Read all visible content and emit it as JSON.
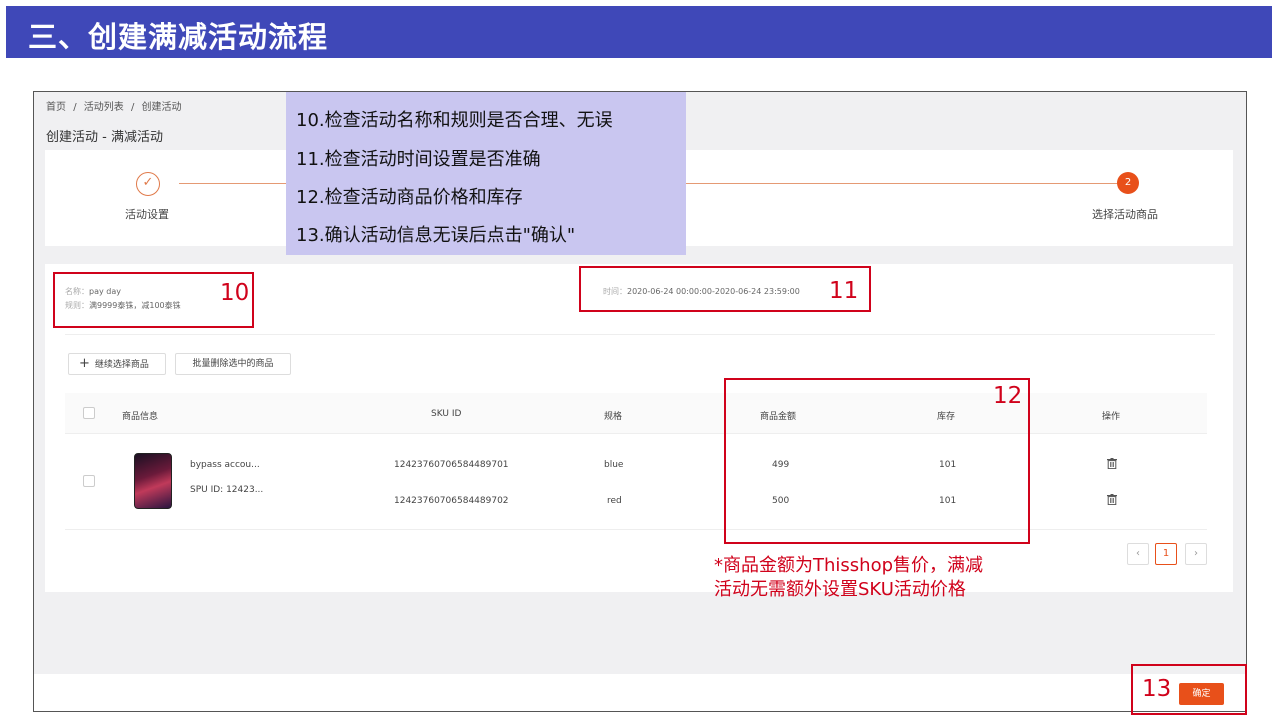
{
  "slide_title": "三、创建满减活动流程",
  "breadcrumb": [
    "首页",
    "/",
    "活动列表",
    "/",
    "创建活动"
  ],
  "page_title": "创建活动 - 满减活动",
  "steps": {
    "step1": {
      "icon": "✓",
      "label": "活动设置"
    },
    "step2": {
      "number": "2",
      "label": "选择活动商品"
    }
  },
  "activity_info": {
    "name_label": "名称：",
    "name_value": "pay day",
    "rule_label": "规则：",
    "rule_value": "满9999泰铢，减100泰铢",
    "time_label": "时间：",
    "time_value": "2020-06-24 00:00:00-2020-06-24 23:59:00"
  },
  "buttons": {
    "add_plus": "+",
    "add_products": "继续选择商品",
    "batch_delete": "批量删除选中的商品",
    "confirm": "确定"
  },
  "table": {
    "headers": {
      "product_info": "商品信息",
      "sku_id": "SKU ID",
      "spec": "规格",
      "price": "商品金额",
      "stock": "库存",
      "actions": "操作"
    },
    "product": {
      "name": "bypass accou...",
      "spu": "SPU ID: 12423..."
    },
    "rows": [
      {
        "sku_id": "1242376070658448970​1",
        "spec": "blue",
        "price": "499",
        "stock": "101"
      },
      {
        "sku_id": "12423760706584489702",
        "spec": "red",
        "price": "500",
        "stock": "101"
      }
    ]
  },
  "pagination": {
    "prev": "‹",
    "page": "1",
    "next": "›"
  },
  "overlay_steps": [
    "10.检查活动名称和规则是否合理、无误",
    "11.检查活动时间设置是否准确",
    "12.检查活动商品价格和库存",
    "13.确认活动信息无误后点击\"确认\""
  ],
  "callouts": {
    "n10": "10",
    "n11": "11",
    "n12": "12",
    "n13": "13"
  },
  "note_lines": [
    "*商品金额为Thisshop售价，满减",
    "活动无需额外设置SKU活动价格"
  ],
  "colors": {
    "title_bar": "#3f48b8",
    "accent": "#e8501a",
    "callout_red": "#d0021b",
    "overlay": "#c9c6f0"
  }
}
